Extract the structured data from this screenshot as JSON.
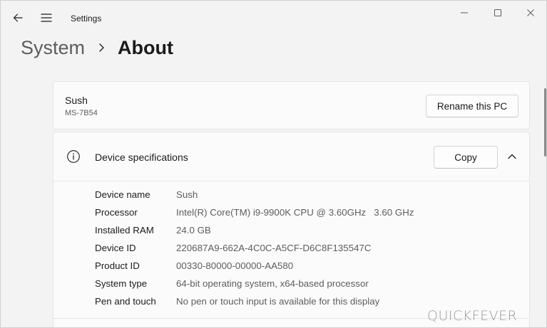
{
  "window": {
    "app_title": "Settings",
    "controls": {
      "minimize": "minimize-icon",
      "maximize": "maximize-icon",
      "close": "close-icon"
    }
  },
  "nav": {
    "back_icon": "back-arrow-icon",
    "menu_icon": "hamburger-menu-icon"
  },
  "breadcrumb": {
    "parent": "System",
    "current": "About"
  },
  "pc_card": {
    "name": "Sush",
    "model": "MS-7B54",
    "rename_label": "Rename this PC"
  },
  "device_specs": {
    "title": "Device specifications",
    "icon": "info-icon",
    "copy_label": "Copy",
    "collapse_icon": "chevron-up-icon",
    "rows": [
      {
        "label": "Device name",
        "value": "Sush"
      },
      {
        "label": "Processor",
        "value": "Intel(R) Core(TM) i9-9900K CPU @ 3.60GHz   3.60 GHz"
      },
      {
        "label": "Installed RAM",
        "value": "24.0 GB"
      },
      {
        "label": "Device ID",
        "value": "220687A9-662A-4C0C-A5CF-D6C8F135547C"
      },
      {
        "label": "Product ID",
        "value": "00330-80000-00000-AA580"
      },
      {
        "label": "System type",
        "value": "64-bit operating system, x64-based processor"
      },
      {
        "label": "Pen and touch",
        "value": "No pen or touch input is available for this display"
      }
    ]
  },
  "watermark": "QUICKFEVER",
  "colors": {
    "window_bg": "#f3f3f3",
    "card_bg": "#fbfbfb",
    "text": "#1b1b1b",
    "secondary_text": "#5d5d5d"
  }
}
